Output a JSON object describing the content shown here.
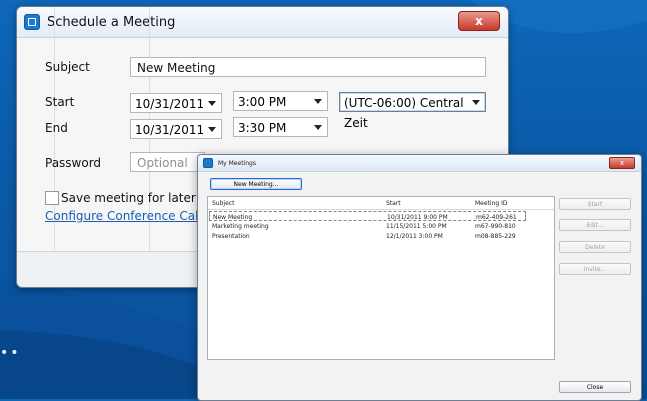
{
  "schedule_dialog": {
    "title": "Schedule a Meeting",
    "close_label": "x",
    "subject_label": "Subject",
    "subject_value": "New Meeting",
    "start_label": "Start",
    "start_date": "10/31/2011",
    "start_time": "3:00 PM",
    "timezone": "(UTC-06:00) Central Zeit",
    "end_label": "End",
    "end_date": "10/31/2011",
    "end_time": "3:30 PM",
    "password_label": "Password",
    "password_placeholder": "Optional",
    "save_label": "Save meeting for later reus",
    "conference_link": "Configure Conference Call"
  },
  "my_meetings": {
    "title": "My Meetings",
    "close_label": "x",
    "new_meeting_button": "New Meeting...",
    "columns": [
      "Subject",
      "Start",
      "Meeting ID"
    ],
    "rows": [
      {
        "subject": "New Meeting",
        "start": "10/31/2011 9:00 PM",
        "meeting_id": "m62-409-261"
      },
      {
        "subject": "Marketing meeting",
        "start": "11/15/2011 5:00 PM",
        "meeting_id": "m67-990-810"
      },
      {
        "subject": "Presentation",
        "start": "12/1/2011 3:00 PM",
        "meeting_id": "m08-885-229"
      }
    ],
    "side_buttons": [
      "Start",
      "Edit...",
      "Delete",
      "Invite..."
    ],
    "close_button": "Close"
  },
  "colors": {
    "background": "#0a5aa8",
    "link": "#1b5eb4",
    "close_red": "#c9382b"
  },
  "decor": {
    "dots": "••"
  }
}
